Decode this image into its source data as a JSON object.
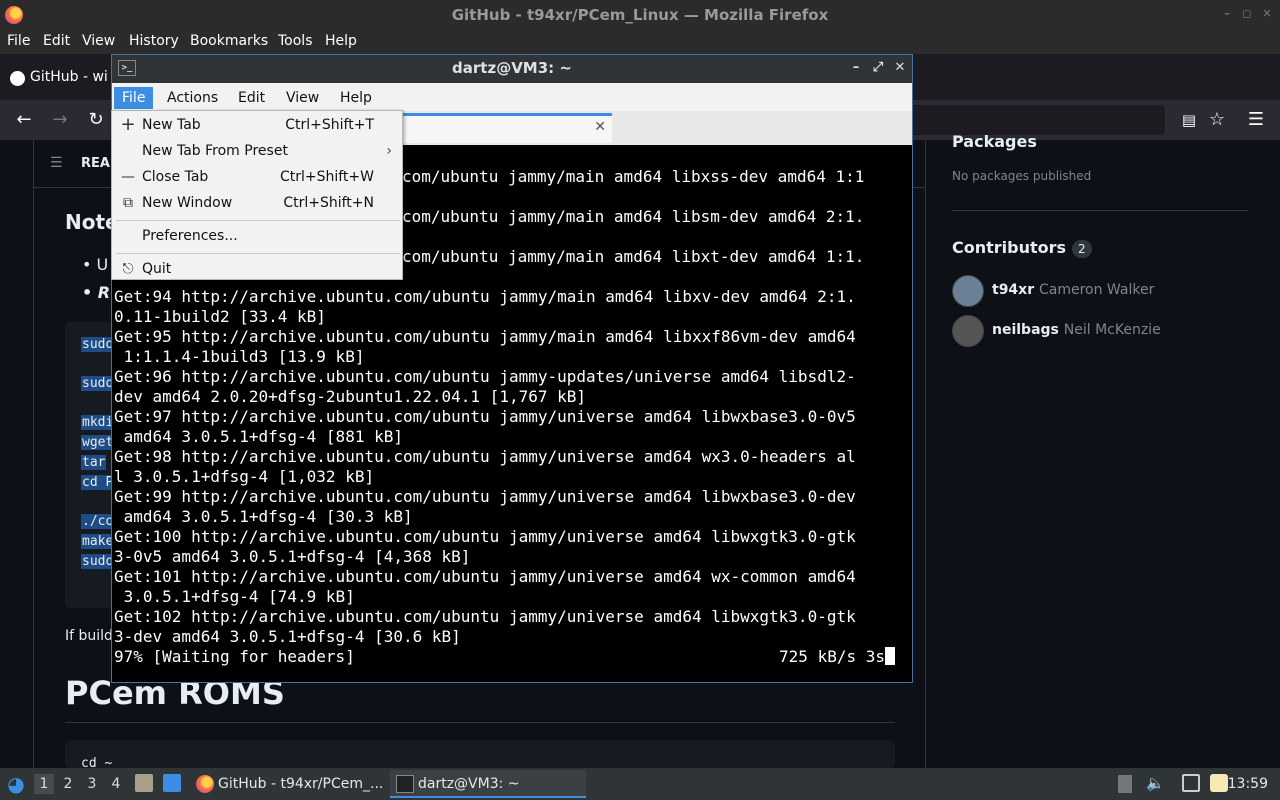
{
  "firefox": {
    "window_title": "GitHub - t94xr/PCem_Linux — Mozilla Firefox",
    "menu": [
      "File",
      "Edit",
      "View",
      "History",
      "Bookmarks",
      "Tools",
      "Help"
    ],
    "tab_title": "GitHub - wi"
  },
  "github": {
    "readme_label": "REA",
    "note_heading": "Note",
    "bullets": [
      "U",
      "R"
    ],
    "code_lines": [
      "sudo",
      "sudo",
      "mkdi",
      "wget",
      "tar",
      "cd P",
      "./co",
      "make",
      "sudo"
    ],
    "if_build": "If build",
    "pcem_heading": "PCem ROMS",
    "cd_line": "cd ~",
    "packages_heading": "Packages",
    "packages_none": "No packages published",
    "contributors_heading": "Contributors",
    "contributors_count": "2",
    "contributors": [
      {
        "login": "t94xr",
        "name": "Cameron Walker"
      },
      {
        "login": "neilbags",
        "name": "Neil McKenzie"
      }
    ]
  },
  "terminal": {
    "title": "dartz@VM3: ~",
    "menu": [
      "File",
      "Actions",
      "Edit",
      "View",
      "Help"
    ],
    "lines": [
      "com/ubuntu jammy/main amd64 libxss-dev amd64 1:1",
      "",
      "com/ubuntu jammy/main amd64 libsm-dev amd64 2:1.",
      "",
      "com/ubuntu jammy/main amd64 libxt-dev amd64 1:1.",
      "",
      "Get:94 http://archive.ubuntu.com/ubuntu jammy/main amd64 libxv-dev amd64 2:1.",
      "0.11-1build2 [33.4 kB]",
      "Get:95 http://archive.ubuntu.com/ubuntu jammy/main amd64 libxxf86vm-dev amd64",
      " 1:1.1.4-1build3 [13.9 kB]",
      "Get:96 http://archive.ubuntu.com/ubuntu jammy-updates/universe amd64 libsdl2-",
      "dev amd64 2.0.20+dfsg-2ubuntu1.22.04.1 [1,767 kB]",
      "Get:97 http://archive.ubuntu.com/ubuntu jammy/universe amd64 libwxbase3.0-0v5",
      " amd64 3.0.5.1+dfsg-4 [881 kB]",
      "Get:98 http://archive.ubuntu.com/ubuntu jammy/universe amd64 wx3.0-headers al",
      "l 3.0.5.1+dfsg-4 [1,032 kB]",
      "Get:99 http://archive.ubuntu.com/ubuntu jammy/universe amd64 libwxbase3.0-dev",
      " amd64 3.0.5.1+dfsg-4 [30.3 kB]",
      "Get:100 http://archive.ubuntu.com/ubuntu jammy/universe amd64 libwxgtk3.0-gtk",
      "3-0v5 amd64 3.0.5.1+dfsg-4 [4,368 kB]",
      "Get:101 http://archive.ubuntu.com/ubuntu jammy/universe amd64 wx-common amd64",
      " 3.0.5.1+dfsg-4 [74.9 kB]",
      "Get:102 http://archive.ubuntu.com/ubuntu jammy/universe amd64 libwxgtk3.0-gtk",
      "3-dev amd64 3.0.5.1+dfsg-4 [30.6 kB]"
    ],
    "status_left": "97% [Waiting for headers]",
    "status_right": "725 kB/s 3s",
    "file_menu": {
      "new_tab": {
        "label": "New Tab",
        "shortcut": "Ctrl+Shift+T"
      },
      "new_tab_preset": {
        "label": "New Tab From Preset"
      },
      "close_tab": {
        "label": "Close Tab",
        "shortcut": "Ctrl+Shift+W"
      },
      "new_window": {
        "label": "New Window",
        "shortcut": "Ctrl+Shift+N"
      },
      "preferences": {
        "label": "Preferences..."
      },
      "quit": {
        "label": "Quit"
      }
    }
  },
  "taskbar": {
    "workspaces": [
      "1",
      "2",
      "3",
      "4"
    ],
    "tasks": [
      "GitHub - t94xr/PCem_...",
      "dartz@VM3: ~"
    ],
    "clock": "13:59"
  },
  "colors": {
    "accent": "#3d8ee2",
    "terminal_bg": "#000000",
    "github_bg": "#0d1117"
  }
}
